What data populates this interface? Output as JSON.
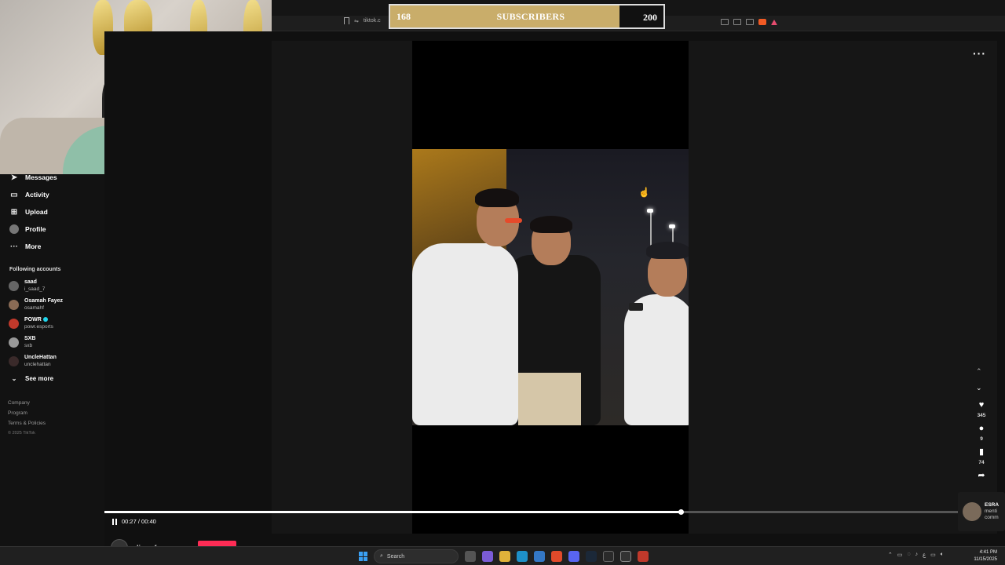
{
  "browser": {
    "url": "tiktok.c"
  },
  "subscriber_goal": {
    "current": "168",
    "label": "SUBSCRIBERS",
    "goal": "200",
    "progress_fraction": 0.84
  },
  "sidebar": {
    "nav": [
      {
        "label": "Messages",
        "icon": "paper-plane-icon"
      },
      {
        "label": "Activity",
        "icon": "inbox-icon"
      },
      {
        "label": "Upload",
        "icon": "plus-square-icon"
      },
      {
        "label": "Profile",
        "icon": "avatar-icon"
      },
      {
        "label": "More",
        "icon": "ellipsis-icon"
      }
    ],
    "following_label": "Following accounts",
    "accounts": [
      {
        "name": "saad",
        "handle": "i_saad_7",
        "verified": false
      },
      {
        "name": "Osamah Fayez",
        "handle": "osamahf",
        "verified": false
      },
      {
        "name": "POWR",
        "handle": "powr.esports",
        "verified": true
      },
      {
        "name": "SXB",
        "handle": "sxb",
        "verified": false
      },
      {
        "name": "UncleHattan",
        "handle": "unclehattan",
        "verified": false
      }
    ],
    "see_more": "See more",
    "footer": {
      "company": "Company",
      "program": "Program",
      "terms": "Terms & Policies",
      "copyright": "© 2025 TikTok"
    }
  },
  "video": {
    "elapsed": "00:27",
    "duration": "00:40",
    "time_display": "00:27 / 00:40",
    "progress_fraction": 0.675,
    "creator": "diy.osf",
    "likes": "345",
    "comments": "9",
    "saves": "74"
  },
  "notification": {
    "name": "ESRA",
    "line2": "menti",
    "line3": "comm"
  },
  "taskbar": {
    "search_placeholder": "Search",
    "clock_time": "4:41 PM",
    "clock_date": "11/15/2025",
    "input_lang": "ع"
  },
  "colors": {
    "accent": "#fe2c55",
    "gold": "#c9ad6a",
    "verified": "#20d5ec"
  }
}
